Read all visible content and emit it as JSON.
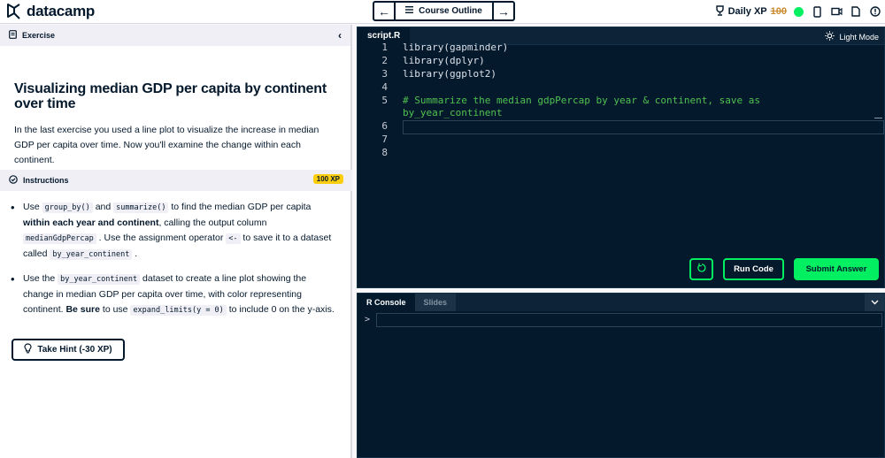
{
  "brand": {
    "name": "datacamp"
  },
  "nav": {
    "prev_label": "←",
    "outline_label": "Course Outline",
    "next_label": "→"
  },
  "header": {
    "daily_xp_label": "Daily XP",
    "xp_value": "100"
  },
  "exercise": {
    "section_label": "Exercise",
    "title": "Visualizing median GDP per capita by continent over time",
    "description": "In the last exercise you used a line plot to visualize the increase in median GDP per capita over time. Now you'll examine the change within each continent."
  },
  "instructions": {
    "section_label": "Instructions",
    "xp_badge": "100 XP",
    "items": [
      {
        "t1": "Use ",
        "c1": "group_by()",
        "t2": " and ",
        "c2": "summarize()",
        "t3": " to find the median GDP per capita ",
        "b1": "within each year and continent",
        "t4": ", calling the output column ",
        "c3": "medianGdpPercap",
        "t5": " . Use the assignment operator ",
        "c4": "<-",
        "t6": " to save it to a dataset called ",
        "c5": "by_year_continent",
        "t7": " ."
      },
      {
        "t1": "Use the ",
        "c1": "by_year_continent",
        "t2": " dataset to create a line plot showing the change in median GDP per capita over time, with color representing continent. ",
        "b1": "Be sure",
        "t3": " to use ",
        "c2": "expand_limits(y = 0)",
        "t4": " to include 0 on the y-axis."
      }
    ],
    "hint_label": "Take Hint (-30 XP)"
  },
  "editor": {
    "tab_label": "script.R",
    "light_mode_label": "Light Mode",
    "lines": [
      {
        "num": "1",
        "text": "library(gapminder)",
        "kind": "code"
      },
      {
        "num": "2",
        "text": "library(dplyr)",
        "kind": "code"
      },
      {
        "num": "3",
        "text": "library(ggplot2)",
        "kind": "code"
      },
      {
        "num": "4",
        "text": "",
        "kind": "code"
      },
      {
        "num": "5",
        "text": "# Summarize the median gdpPercap by year & continent, save as",
        "kind": "comment"
      },
      {
        "num": "",
        "text": "by_year_continent",
        "kind": "comment"
      },
      {
        "num": "6",
        "text": "",
        "kind": "code"
      },
      {
        "num": "7",
        "text": "",
        "kind": "code"
      },
      {
        "num": "8",
        "text": "",
        "kind": "code"
      }
    ],
    "run_label": "Run Code",
    "submit_label": "Submit Answer"
  },
  "console": {
    "tabs": [
      "R Console",
      "Slides"
    ],
    "prompt": ">"
  },
  "colors": {
    "accent_green": "#03ef62",
    "navy": "#05192d",
    "badge_yellow": "#fcce0d"
  }
}
